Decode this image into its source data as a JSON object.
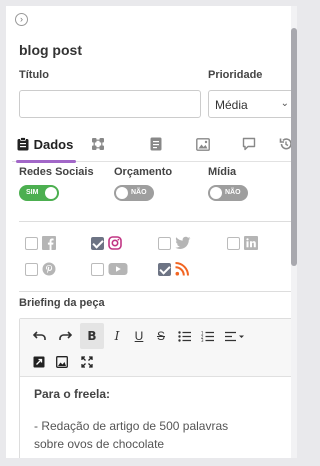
{
  "header": {
    "collapse_icon": "chevron-right-circle-icon",
    "title": "blog post"
  },
  "form": {
    "titulo_label": "Título",
    "titulo_value": "",
    "prioridade_label": "Prioridade",
    "prioridade_value": "Média"
  },
  "tabs": [
    {
      "label": "Dados",
      "icon": "clipboard-icon",
      "active": true
    },
    {
      "label": "",
      "icon": "flow-icon"
    },
    {
      "label": "",
      "icon": "document-icon"
    },
    {
      "label": "",
      "icon": "image-icon"
    },
    {
      "label": "",
      "icon": "comment-icon"
    },
    {
      "label": "",
      "icon": "history-icon"
    }
  ],
  "toggles": {
    "redes_label": "Redes Sociais",
    "redes_state": "SIM",
    "orcamento_label": "Orçamento",
    "orcamento_state": "NÃO",
    "midia_label": "Mídia",
    "midia_state": "NÃO"
  },
  "social_networks": [
    {
      "icon": "facebook-icon",
      "checked": false,
      "color": "#b5b5b5"
    },
    {
      "icon": "instagram-icon",
      "checked": true,
      "color": "#c13584"
    },
    {
      "icon": "twitter-icon",
      "checked": false,
      "color": "#b5b5b5"
    },
    {
      "icon": "linkedin-icon",
      "checked": false,
      "color": "#b5b5b5"
    },
    {
      "icon": "pinterest-icon",
      "checked": false,
      "color": "#b5b5b5"
    },
    {
      "icon": "youtube-icon",
      "checked": false,
      "color": "#b5b5b5"
    },
    {
      "icon": "rss-icon",
      "checked": true,
      "color": "#f26522"
    }
  ],
  "briefing": {
    "label": "Briefing da peça",
    "heading": "Para o freela:",
    "line1": "- Redação de artigo de 500 palavras",
    "line2": "sobre ovos de chocolate"
  },
  "colors": {
    "accent": "#a267c8",
    "toggle_on": "#4caf50",
    "toggle_off": "#9e9e9e"
  }
}
